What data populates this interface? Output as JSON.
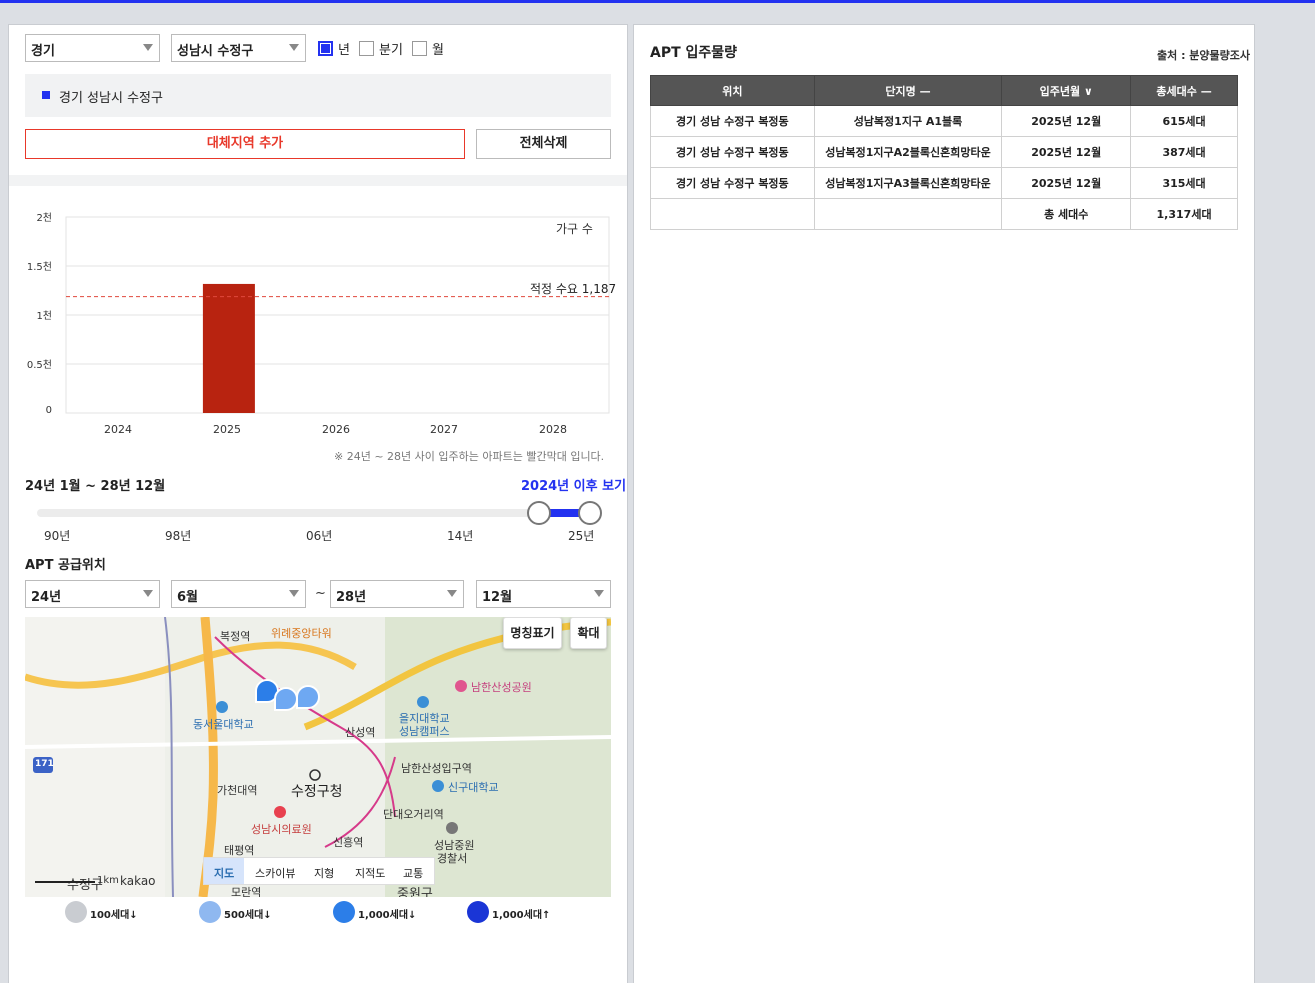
{
  "filters": {
    "province": "경기",
    "city": "성남시 수정구",
    "period_options": [
      {
        "label": "년",
        "checked": true
      },
      {
        "label": "분기",
        "checked": false
      },
      {
        "label": "월",
        "checked": false
      }
    ]
  },
  "region": {
    "selected": "경기 성남시 수정구"
  },
  "buttons": {
    "add_alt_region": "대체지역 추가",
    "delete_all": "전체삭제"
  },
  "chart_data": {
    "type": "bar",
    "categories": [
      "2024",
      "2025",
      "2026",
      "2027",
      "2028"
    ],
    "values": [
      0,
      1317,
      0,
      0,
      0
    ],
    "ylim": [
      0,
      2000
    ],
    "ytick_labels": [
      "0",
      "0.5천",
      "1천",
      "1.5천",
      "2천"
    ],
    "ylabel": "가구 수",
    "reference_line": {
      "label": "적정 수요 1,187",
      "value": 1187,
      "color": "#e0483c"
    },
    "bar_color": "#b82310",
    "grid": true,
    "note": "※ 24년 ~ 28년 사이 입주하는 아파트는 빨간막대 입니다."
  },
  "range": {
    "label": "24년 1월 ~ 28년 12월",
    "link": "2024년 이후 보기",
    "slider_labels": [
      "90년",
      "98년",
      "06년",
      "14년",
      "25년"
    ]
  },
  "supply": {
    "title": "APT 공급위치",
    "from_year": "24년",
    "from_month": "6월",
    "tilde": "~",
    "to_year": "28년",
    "to_month": "12월"
  },
  "map": {
    "btn_names": "명칭표기",
    "btn_zoom": "확대",
    "types": [
      "지도",
      "스카이뷰",
      "지형",
      "지적도",
      "교통"
    ],
    "scale": "1km",
    "brand": "kakao",
    "labels": [
      "복정역",
      "위례중앙타워",
      "남한산성공원",
      "동서울대학교",
      "을지대학교",
      "성남캠퍼스",
      "산성역",
      "171",
      "남한산성입구역",
      "신구대학교",
      "수정구청",
      "가천대역",
      "단대오거리역",
      "성남시의료원",
      "신흥역",
      "성남중원",
      "경찰서",
      "태평역",
      "수정구",
      "모란역",
      "중원구"
    ]
  },
  "legend": [
    "100세대↓",
    "500세대↓",
    "1,000세대↓",
    "1,000세대↑"
  ],
  "table": {
    "title": "APT 입주물량",
    "source": "출처 : 분양물량조사",
    "headers": [
      "위치",
      "단지명 —",
      "입주년월 ∨",
      "총세대수 —"
    ],
    "rows": [
      [
        "경기 성남 수정구 복정동",
        "성남복정1지구 A1블록",
        "2025년 12월",
        "615세대"
      ],
      [
        "경기 성남 수정구 복정동",
        "성남복정1지구A2블록신혼희망타운",
        "2025년 12월",
        "387세대"
      ],
      [
        "경기 성남 수정구 복정동",
        "성남복정1지구A3블록신혼희망타운",
        "2025년 12월",
        "315세대"
      ],
      [
        "",
        "",
        "총 세대수",
        "1,317세대"
      ]
    ]
  }
}
